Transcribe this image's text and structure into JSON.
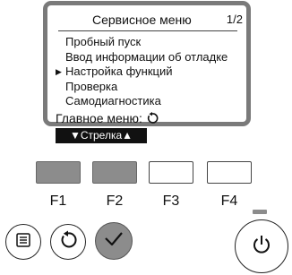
{
  "screen": {
    "title": "Сервисное меню",
    "page": "1/2",
    "items": [
      {
        "label": "Пробный пуск",
        "selected": false
      },
      {
        "label": "Ввод информации об отладке",
        "selected": false
      },
      {
        "label": "Настройка функций",
        "selected": true
      },
      {
        "label": "Проверка",
        "selected": false
      },
      {
        "label": "Самодиагностика",
        "selected": false
      }
    ],
    "footer_label": "Главное меню:",
    "arrow_hint": "▼Стрелка▲",
    "selection_marker": "▶"
  },
  "function_keys": [
    "F1",
    "F2",
    "F3",
    "F4"
  ],
  "buttons": {
    "menu_icon": "menu-list-icon",
    "back_icon": "return-arrow-icon",
    "ok_icon": "checkmark-icon",
    "power_icon": "power-icon"
  },
  "colors": {
    "key_dark": "#8c8c8c",
    "lcd_border": "#7a7a7a",
    "arrow_bar": "#111111"
  }
}
